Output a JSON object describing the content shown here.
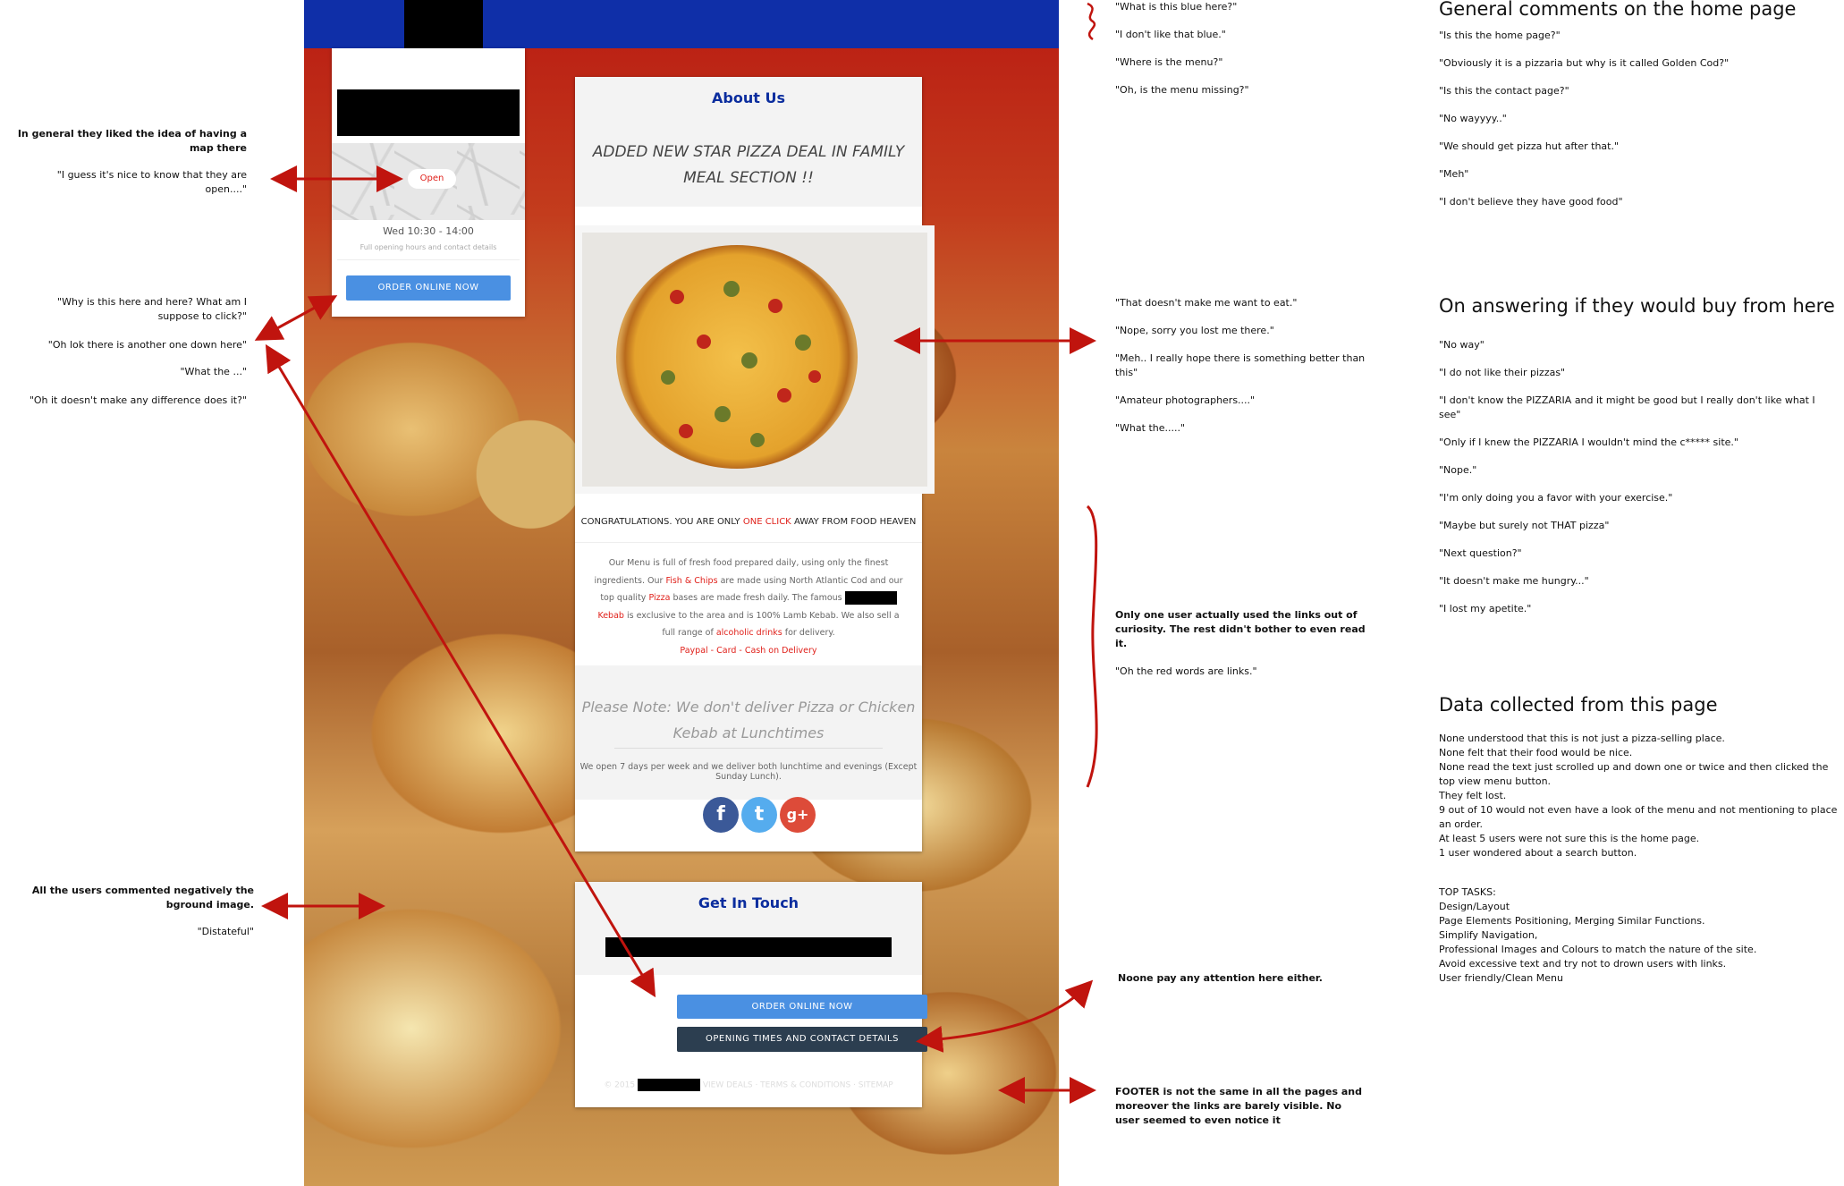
{
  "site": {
    "side_card": {
      "open_label": "Open",
      "hours": "Wed 10:30 - 14:00",
      "hours_sub": "Full opening hours and contact details",
      "order_button": "ORDER ONLINE NOW"
    },
    "about": {
      "title": "About Us",
      "promo": "ADDED NEW STAR PIZZA DEAL IN FAMILY MEAL SECTION !!",
      "congrats_prefix": "CONGRATULATIONS. YOU ARE ONLY",
      "congrats_link": "ONE CLICK",
      "congrats_suffix": "AWAY FROM FOOD HEAVEN",
      "menu_text": {
        "p1": "Our Menu is full of fresh food prepared daily, using only the finest ingredients. Our",
        "link_fish": "Fish & Chips",
        "p2": "are made using North Atlantic Cod and our top quality",
        "link_pizza": "Pizza",
        "p3": "bases are made fresh daily. The famous",
        "link_kebab": "Kebab",
        "p4": "is exclusive to the area and is 100% Lamb Kebab. We also sell a full range of",
        "link_drinks": "alcoholic drinks",
        "p5": "for delivery.",
        "payments": "Paypal - Card - Cash on Delivery"
      },
      "note": "Please Note: We don't deliver Pizza or Chicken Kebab at Lunchtimes",
      "open_days": "We open 7 days per week and we deliver both lunchtime and evenings (Except Sunday Lunch).",
      "social": [
        "f",
        "t",
        "g+"
      ]
    },
    "contact": {
      "title": "Get In Touch",
      "order_button": "ORDER ONLINE NOW",
      "times_button": "OPENING TIMES AND CONTACT DETAILS",
      "footer_prefix": "© 2015",
      "footer_links": "VIEW DEALS · TERMS & CONDITIONS · SITEMAP"
    }
  },
  "annotations": {
    "left": {
      "map_intro": "In general they liked the idea of having a map there",
      "map_quote": "\"I guess it's nice to know that they are open....\"",
      "why_here": "\"Why is this here and here? What am I suppose to click?\"",
      "another_one": "\"Oh lok there is another one down here\"",
      "what_the": "\"What the ...\"",
      "no_difference": "\"Oh it doesn't make any difference does it?\"",
      "bground": "All the users commented negatively the bground image.",
      "distasteful": "\"Distateful\""
    },
    "middle_top": [
      "\"What is this blue here?\"",
      "\"I don't like that blue.\"",
      "\"Where is the menu?\"",
      "\"Oh, is the menu missing?\""
    ],
    "middle_pizza": [
      "\"That doesn't make me want to eat.\"",
      "\"Nope, sorry you lost me there.\"",
      "\"Meh.. I really hope there is something better than this\"",
      "\"Amateur photographers....\"",
      "\"What the.....\""
    ],
    "middle_links": {
      "bold": "Only one user actually used the links out of curiosity. The rest didn't bother to even read it.",
      "quote": "\"Oh the red words are links.\""
    },
    "middle_noone": "Noone pay any attention here either.",
    "middle_footer": "FOOTER is not the same in all the pages and moreover the links are barely visible. No user seemed to even notice it",
    "right": {
      "general_heading": "General comments on the home page",
      "general_items": [
        "\"Is this the home page?\"",
        "\"Obviously it is a pizzaria but why is it called Golden Cod?\"",
        "\"Is this the contact page?\"",
        "\"No wayyyy..\"",
        "\"We should get pizza hut after that.\"",
        "\"Meh\"",
        "\"I don't believe they have good food\""
      ],
      "buy_heading": "On answering if they would buy from here",
      "buy_items": [
        "\"No way\"",
        "\"I do not like their pizzas\"",
        "\"I don't know the PIZZARIA and it might be good but I really don't like what I see\"",
        "\"Only if I knew the PIZZARIA I wouldn't mind the c***** site.\"",
        "\"Nope.\"",
        "\"I'm only doing you a favor with your exercise.\"",
        "\"Maybe but surely not THAT pizza\"",
        "\"Next question?\"",
        "\"It doesn't make me hungry...\"",
        "\"I lost my apetite.\""
      ],
      "data_heading": "Data collected from this page",
      "data_items": [
        "None understood that this is not just a pizza-selling place.",
        "None felt that their food would be nice.",
        "None read the text just scrolled up and down one or twice and then clicked the top view menu button.",
        "They felt lost.",
        "9 out of 10 would not even have a look of the menu and not mentioning to place an order.",
        "At least 5 users were not sure this is the home page.",
        "1 user wondered about a search button."
      ],
      "tasks_heading": "TOP TASKS:",
      "tasks_items": [
        "Design/Layout",
        "Page Elements Positioning, Merging Similar Functions.",
        "Simplify Navigation,",
        "Professional Images and Colours to match the nature of the site.",
        "Avoid excessive text and try not to drown users with links.",
        "User friendly/Clean Menu"
      ]
    }
  }
}
